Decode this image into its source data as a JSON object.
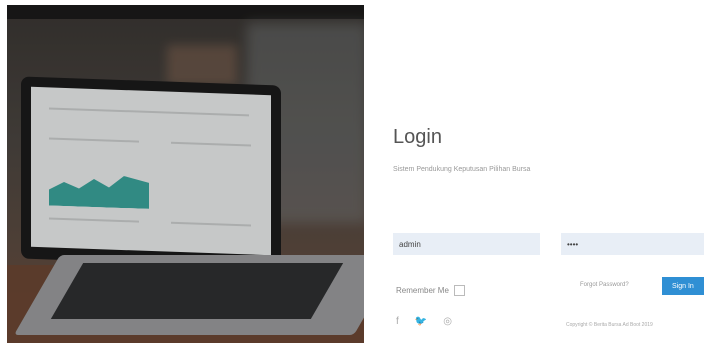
{
  "login": {
    "title": "Login",
    "subtitle": "Sistem Pendukung Keputusan Pilihan Bursa",
    "username_value": "admin",
    "password_value": "••••",
    "remember_label": "Remember Me",
    "forgot_label": "Forgot Password?",
    "signin_label": "Sign In",
    "copyright": "Copyright © Berita Bursa Ad Boot 2019"
  },
  "social": {
    "icons": [
      "facebook-icon",
      "twitter-icon",
      "instagram-icon"
    ],
    "glyphs": [
      "f",
      "🐦",
      "◎"
    ]
  },
  "colors": {
    "accent": "#2f8fd4",
    "field_bg": "#e8eef6"
  }
}
